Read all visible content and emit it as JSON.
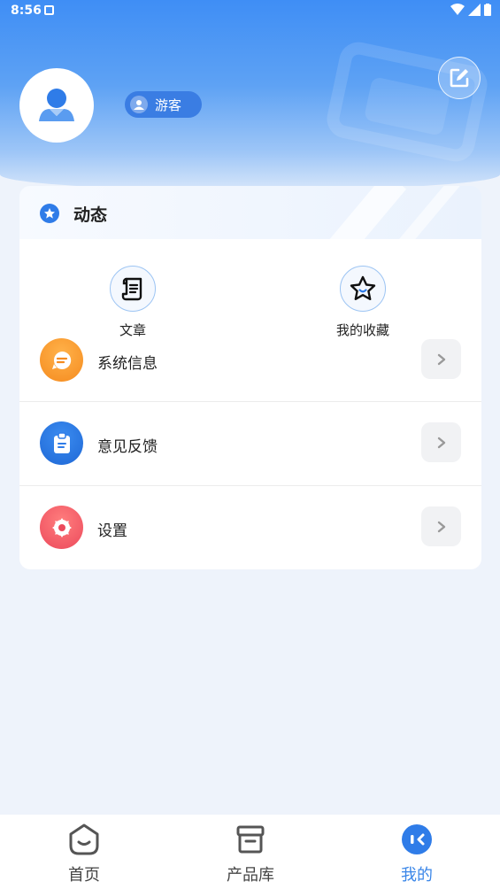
{
  "status_bar": {
    "time": "8:56"
  },
  "profile": {
    "badge_label": "游客"
  },
  "section": {
    "title": "动态"
  },
  "quick_actions": [
    {
      "label": "文章",
      "icon": "scroll-icon"
    },
    {
      "label": "我的收藏",
      "icon": "star-icon"
    }
  ],
  "menu": [
    {
      "label": "系统信息",
      "icon": "message-icon",
      "color": "#f58b1f"
    },
    {
      "label": "意见反馈",
      "icon": "clipboard-icon",
      "color": "#2f7ce8"
    },
    {
      "label": "设置",
      "icon": "gear-icon",
      "color": "#ee4f63"
    }
  ],
  "bottom_nav": [
    {
      "label": "首页",
      "icon": "home-face-icon",
      "active": false
    },
    {
      "label": "产品库",
      "icon": "box-icon",
      "active": false
    },
    {
      "label": "我的",
      "icon": "profile-icon",
      "active": true
    }
  ],
  "colors": {
    "accent": "#3a86e8",
    "header_top": "#3f8ef5",
    "background": "#eef3fb"
  }
}
